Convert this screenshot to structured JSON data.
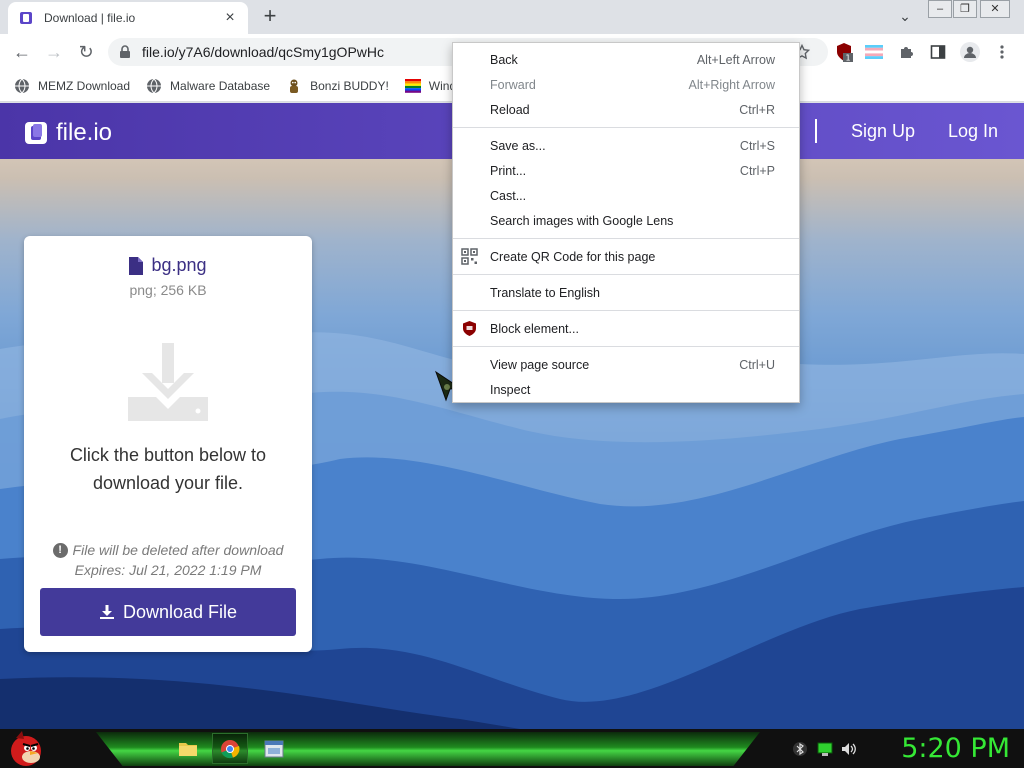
{
  "browser": {
    "tab_title": "Download | file.io",
    "tab_close_glyph": "×",
    "newtab_glyph": "+",
    "tabsearch_glyph": "⌄",
    "window_controls": [
      "–",
      "❐",
      "✕"
    ],
    "nav": {
      "back_glyph": "←",
      "forward_glyph": "→",
      "reload_glyph": "↻"
    },
    "url": "file.io/y7A6/download/qcSmy1gOPwHc",
    "extensions": [
      "bookmark-star-icon",
      "ublock-icon",
      "flag-icon",
      "puzzle-icon",
      "sidepanel-icon",
      "profile-icon",
      "more-icon"
    ],
    "ublock_badge": "1"
  },
  "bookmarks": [
    {
      "label": "MEMZ Download",
      "icon": "globe-icon"
    },
    {
      "label": "Malware Database",
      "icon": "globe-icon"
    },
    {
      "label": "Bonzi BUDDY!",
      "icon": "bonzi-icon"
    },
    {
      "label": "Wind",
      "icon": "windows-icon"
    }
  ],
  "site": {
    "brand": "file.io",
    "nav_signup": "Sign Up",
    "nav_login": "Log In",
    "colors": {
      "navbar_start": "#4b35a8",
      "navbar_end": "#6a56d1",
      "button": "#433a9a"
    }
  },
  "card": {
    "file_name": "bg.png",
    "file_meta": "png; 256 KB",
    "instructions": "Click the button below to download your file.",
    "warning_glyph": "!",
    "warning": "File will be deleted after download",
    "expires": "Expires: Jul 21, 2022 1:19 PM",
    "button_label": "Download File"
  },
  "context_menu": {
    "groups": [
      [
        {
          "label": "Back",
          "shortcut": "Alt+Left Arrow",
          "enabled": true
        },
        {
          "label": "Forward",
          "shortcut": "Alt+Right Arrow",
          "enabled": false
        },
        {
          "label": "Reload",
          "shortcut": "Ctrl+R",
          "enabled": true
        }
      ],
      [
        {
          "label": "Save as...",
          "shortcut": "Ctrl+S",
          "enabled": true
        },
        {
          "label": "Print...",
          "shortcut": "Ctrl+P",
          "enabled": true
        },
        {
          "label": "Cast...",
          "shortcut": "",
          "enabled": true
        },
        {
          "label": "Search images with Google Lens",
          "shortcut": "",
          "enabled": true
        }
      ],
      [
        {
          "label": "Create QR Code for this page",
          "shortcut": "",
          "enabled": true,
          "icon": "qr-code-icon"
        }
      ],
      [
        {
          "label": "Translate to English",
          "shortcut": "",
          "enabled": true
        }
      ],
      [
        {
          "label": "Block element...",
          "shortcut": "",
          "enabled": true,
          "icon": "ublock-icon"
        }
      ],
      [
        {
          "label": "View page source",
          "shortcut": "Ctrl+U",
          "enabled": true
        },
        {
          "label": "Inspect",
          "shortcut": "",
          "enabled": true
        }
      ]
    ]
  },
  "taskbar": {
    "clock": "5:20 PM",
    "items": [
      "file-explorer-icon",
      "chrome-icon",
      "window-icon"
    ],
    "active_item": "chrome-icon",
    "tray": [
      "bluetooth-icon",
      "network-icon",
      "volume-icon"
    ],
    "clock_color": "#35e835"
  }
}
